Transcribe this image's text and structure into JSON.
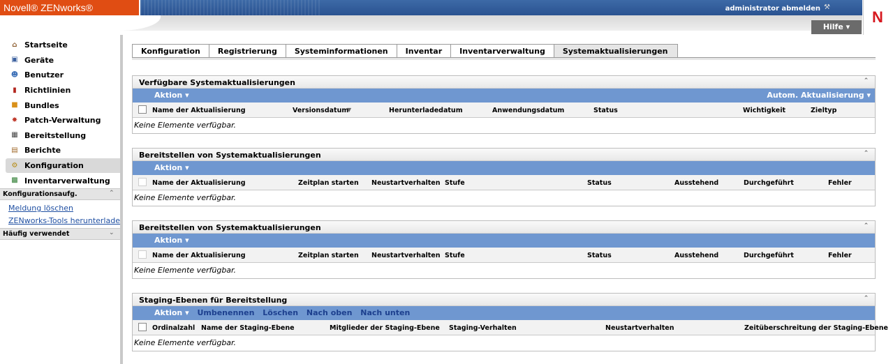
{
  "header": {
    "brand": "Novell® ZENworks®",
    "logout": "administrator abmelden",
    "help": "Hilfe ▾",
    "vendor_letter": "N"
  },
  "sidebar": {
    "items": [
      {
        "label": "Startseite",
        "icon": "home-icon"
      },
      {
        "label": "Geräte",
        "icon": "monitor-icon"
      },
      {
        "label": "Benutzer",
        "icon": "user-icon"
      },
      {
        "label": "Richtlinien",
        "icon": "policy-icon"
      },
      {
        "label": "Bundles",
        "icon": "bundle-icon"
      },
      {
        "label": "Patch-Verwaltung",
        "icon": "patch-icon"
      },
      {
        "label": "Bereitstellung",
        "icon": "deploy-icon"
      },
      {
        "label": "Berichte",
        "icon": "report-icon"
      },
      {
        "label": "Konfiguration",
        "icon": "config-icon"
      },
      {
        "label": "Inventarverwaltung",
        "icon": "inventory-icon"
      }
    ],
    "tasks_title": "Konfigurationsaufg.",
    "tasks": [
      "Meldung löschen",
      "ZENworks-Tools herunterladen"
    ],
    "frequent_title": "Häufig verwendet"
  },
  "tabs": [
    "Konfiguration",
    "Registrierung",
    "Systeminformationen",
    "Inventar",
    "Inventarverwaltung",
    "Systemaktualisierungen"
  ],
  "panels": {
    "available": {
      "title": "Verfügbare Systemaktualisierungen",
      "action": "Aktion ▾",
      "auto": "Autom. Aktualisierung ▾",
      "columns": [
        "Name der Aktualisierung",
        "Versionsdatum",
        "Herunterladedatum",
        "Anwendungsdatum",
        "Status",
        "Wichtigkeit",
        "Zieltyp"
      ],
      "empty": "Keine Elemente verfügbar."
    },
    "deploy1": {
      "title": "Bereitstellen von Systemaktualisierungen",
      "action": "Aktion ▾",
      "columns": [
        "Name der Aktualisierung",
        "Zeitplan starten",
        "Neustartverhalten",
        "Stufe",
        "Status",
        "Ausstehend",
        "Durchgeführt",
        "Fehler"
      ],
      "empty": "Keine Elemente verfügbar."
    },
    "deploy2": {
      "title": "Bereitstellen von Systemaktualisierungen",
      "action": "Aktion ▾",
      "columns": [
        "Name der Aktualisierung",
        "Zeitplan starten",
        "Neustartverhalten",
        "Stufe",
        "Status",
        "Ausstehend",
        "Durchgeführt",
        "Fehler"
      ],
      "empty": "Keine Elemente verfügbar."
    },
    "staging": {
      "title": "Staging-Ebenen für Bereitstellung",
      "action": "Aktion ▾",
      "buttons": [
        "Umbenennen",
        "Löschen",
        "Nach oben",
        "Nach unten"
      ],
      "columns": [
        "Ordinalzahl",
        "Name der Staging-Ebene",
        "Mitglieder der Staging-Ebene",
        "Staging-Verhalten",
        "Neustartverhalten",
        "Zeitüberschreitung der Staging-Ebene"
      ],
      "empty": "Keine Elemente verfügbar."
    }
  },
  "colors": {
    "brand_orange": "#e04d13",
    "header_blue": "#2f5a98",
    "action_bar": "#6f97d0",
    "novell_red": "#d71920"
  }
}
